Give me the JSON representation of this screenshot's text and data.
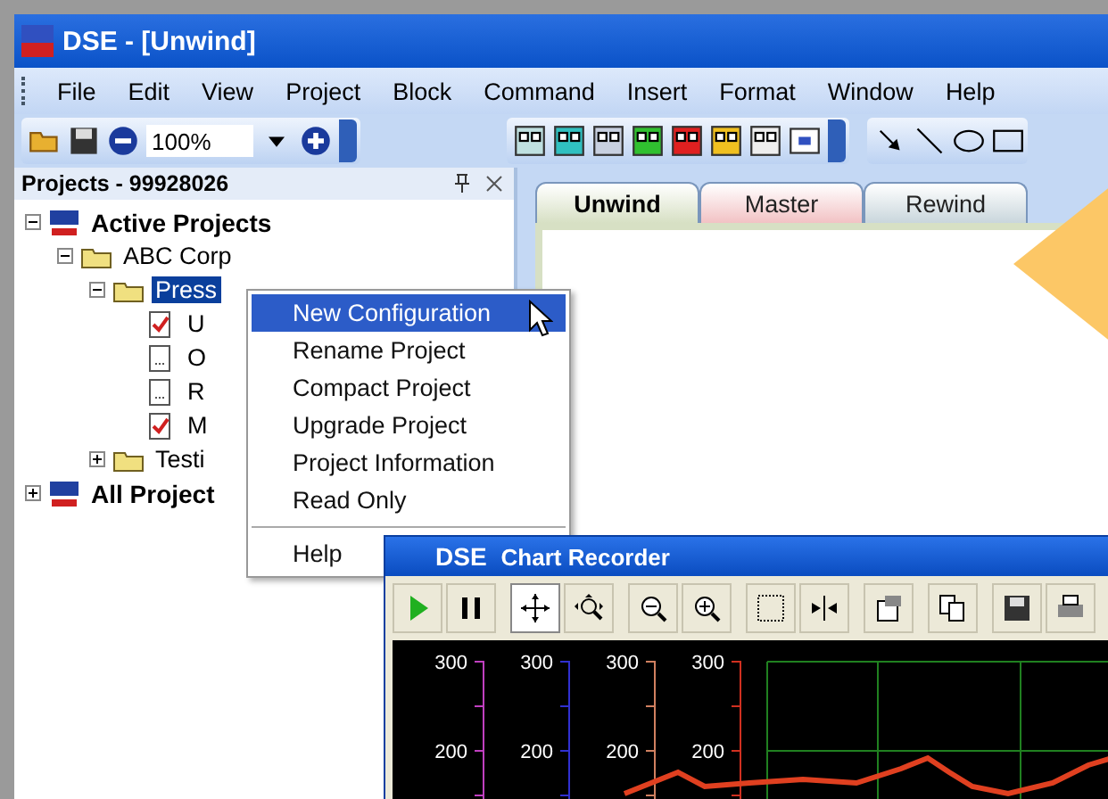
{
  "window": {
    "title": "DSE - [Unwind]"
  },
  "menu_bar": [
    "File",
    "Edit",
    "View",
    "Project",
    "Block",
    "Command",
    "Insert",
    "Format",
    "Window",
    "Help"
  ],
  "toolbar": {
    "zoom": "100%"
  },
  "projects_panel": {
    "title": "Projects - 99928026",
    "tree": [
      {
        "label": "Active Projects",
        "kind": "root",
        "expanded": true,
        "selected": false,
        "children": [
          {
            "label": "ABC Corp",
            "kind": "folder",
            "expanded": true,
            "selected": false,
            "children": [
              {
                "label": "Press",
                "kind": "folder",
                "expanded": true,
                "selected": true,
                "children": [
                  {
                    "label": "U",
                    "kind": "checked-document",
                    "selected": false
                  },
                  {
                    "label": "O",
                    "kind": "document",
                    "selected": false
                  },
                  {
                    "label": "R",
                    "kind": "document",
                    "selected": false
                  },
                  {
                    "label": "M",
                    "kind": "checked-document",
                    "selected": false
                  }
                ]
              },
              {
                "label": "Testi",
                "kind": "folder",
                "expanded": false,
                "selected": false
              }
            ]
          }
        ]
      },
      {
        "label": "All Project",
        "kind": "root",
        "expanded": false,
        "selected": false
      }
    ]
  },
  "tabs": [
    {
      "label": "Unwind",
      "selected": true,
      "color": "#d7e0c4"
    },
    {
      "label": "Master",
      "selected": false,
      "color": "#f2c2c4"
    },
    {
      "label": "Rewind",
      "selected": false,
      "color": "#c9d6dc"
    }
  ],
  "context_menu": [
    {
      "kind": "item",
      "label": "New Configuration",
      "selected": true
    },
    {
      "kind": "item",
      "label": "Rename Project",
      "selected": false
    },
    {
      "kind": "item",
      "label": "Compact Project",
      "selected": false
    },
    {
      "kind": "item",
      "label": "Upgrade Project",
      "selected": false
    },
    {
      "kind": "item",
      "label": "Project Information",
      "selected": false
    },
    {
      "kind": "item",
      "label": "Read Only",
      "selected": false
    },
    {
      "kind": "separator"
    },
    {
      "kind": "item",
      "label": "Help",
      "selected": false
    }
  ],
  "chart_recorder": {
    "logo": "DSE",
    "title": "Chart Recorder",
    "buttons": [
      {
        "kind": "play",
        "selected": false
      },
      {
        "kind": "pause",
        "selected": false
      },
      {
        "kind": "pan",
        "selected": true
      },
      {
        "kind": "zoom-fit",
        "selected": false
      },
      {
        "kind": "zoom-out",
        "selected": false
      },
      {
        "kind": "zoom-in",
        "selected": false
      },
      {
        "kind": "select",
        "selected": false
      },
      {
        "kind": "marker",
        "selected": false
      },
      {
        "kind": "properties",
        "selected": false
      },
      {
        "kind": "copy",
        "selected": false
      },
      {
        "kind": "save",
        "selected": false
      },
      {
        "kind": "print",
        "selected": false
      }
    ],
    "axes": [
      {
        "color": "#c040c0",
        "ticks": [
          "300",
          "200"
        ]
      },
      {
        "color": "#3030d0",
        "ticks": [
          "300",
          "200"
        ]
      },
      {
        "color": "#d08060",
        "ticks": [
          "300",
          "200"
        ]
      },
      {
        "color": "#d03020",
        "ticks": [
          "300",
          "200"
        ]
      }
    ]
  }
}
